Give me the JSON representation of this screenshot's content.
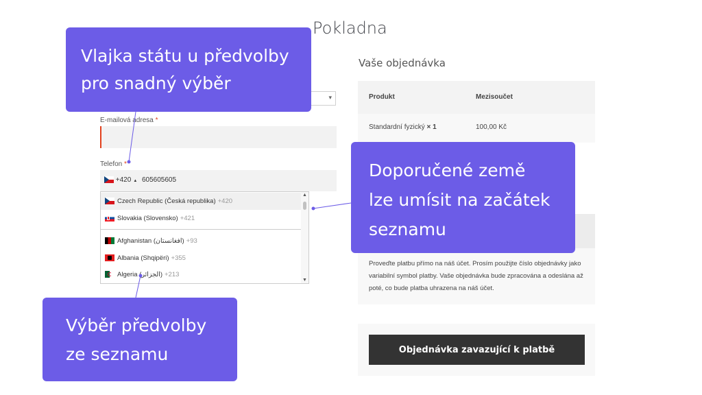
{
  "page_title": "Pokladna",
  "billing": {
    "email_label": "E-mailová adresa",
    "required_mark": "*",
    "email_value": "",
    "phone_label": "Telefon",
    "phone_dial": "+420",
    "phone_caret": "▲",
    "phone_number": "605605605",
    "select_arrow": "▾"
  },
  "dropdown": {
    "items": [
      {
        "flag": "flag-cz",
        "name": "Czech Republic (Česká republika)",
        "dial": "+420"
      },
      {
        "flag": "flag-sk",
        "name": "Slovakia (Slovensko)",
        "dial": "+421"
      },
      {
        "flag": "flag-af",
        "name": "Afghanistan (‫افغانستان‬‎)",
        "dial": "+93"
      },
      {
        "flag": "flag-al",
        "name": "Albania (Shqipëri)",
        "dial": "+355"
      },
      {
        "flag": "flag-dz",
        "name": "Algeria (‫الجزائر‬‎)",
        "dial": "+213"
      }
    ],
    "scroll_up": "▲",
    "scroll_down": "▼"
  },
  "order": {
    "heading": "Vaše objednávka",
    "col_product": "Produkt",
    "col_subtotal": "Mezisoučet",
    "row_product": "Standardní fyzický",
    "row_qty": "× 1",
    "row_subtotal": "100,00 Kč",
    "payment_description": "Proveďte platbu přímo na náš účet. Prosím použijte číslo objednávky jako variabilní symbol platby. Vaše objednávka bude zpracována a odeslána až poté, co bude platba uhrazena na náš účet.",
    "submit_label": "Objednávka zavazující k platbě"
  },
  "callouts": {
    "flag_note_line1": "Vlajka státu u předvolby",
    "flag_note_line2": "pro snadný výběr",
    "recommended_line1": "Doporučené země",
    "recommended_line2": "lze umísit na začátek",
    "recommended_line3": "seznamu",
    "select_line1": "Výběr předvolby",
    "select_line2": "ze seznamu"
  },
  "colors": {
    "callout_bg": "#6c5ce7",
    "button_bg": "#333333",
    "required": "#e2401c"
  }
}
